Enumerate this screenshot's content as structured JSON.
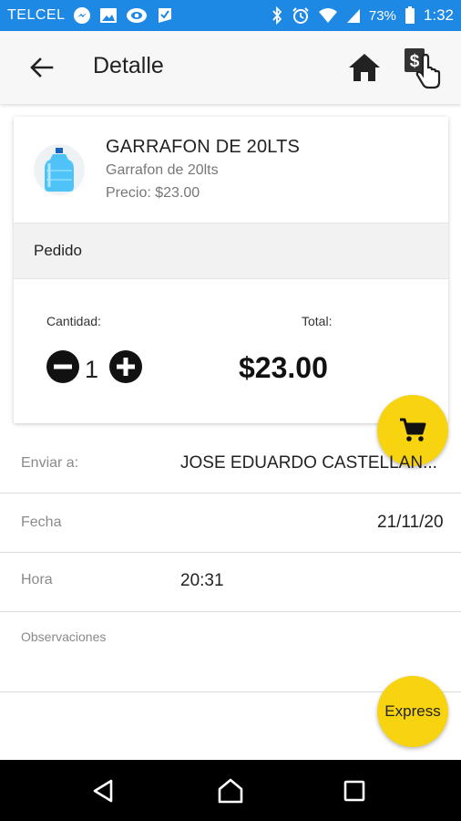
{
  "status_bar": {
    "carrier": "TELCEL",
    "battery": "73%",
    "time": "1:32"
  },
  "app_bar": {
    "title": "Detalle",
    "icons": [
      "arrow-back-icon",
      "home-icon",
      "money-hand-icon"
    ]
  },
  "product": {
    "name": "GARRAFON DE 20LTS",
    "description": "Garrafon de 20lts",
    "price": "Precio: $23.00",
    "image": "water-jug-icon"
  },
  "order": {
    "section_title": "Pedido",
    "quantity_label": "Cantidad:",
    "quantity": "1",
    "total_label": "Total:",
    "total": "$23.00"
  },
  "form": {
    "send_to_label": "Enviar a:",
    "send_to_value": "JOSE EDUARDO CASTELLAN...",
    "date_label": "Fecha",
    "date_value": "21/11/20",
    "time_label": "Hora",
    "time_value": "20:31",
    "notes_label": "Observaciones",
    "notes_value": ""
  },
  "fabs": {
    "cart_icon": "cart-icon",
    "express_label": "Express"
  },
  "colors": {
    "status_bar": "#1e88e5",
    "accent": "#f7d310",
    "nav_bar": "#000000"
  }
}
